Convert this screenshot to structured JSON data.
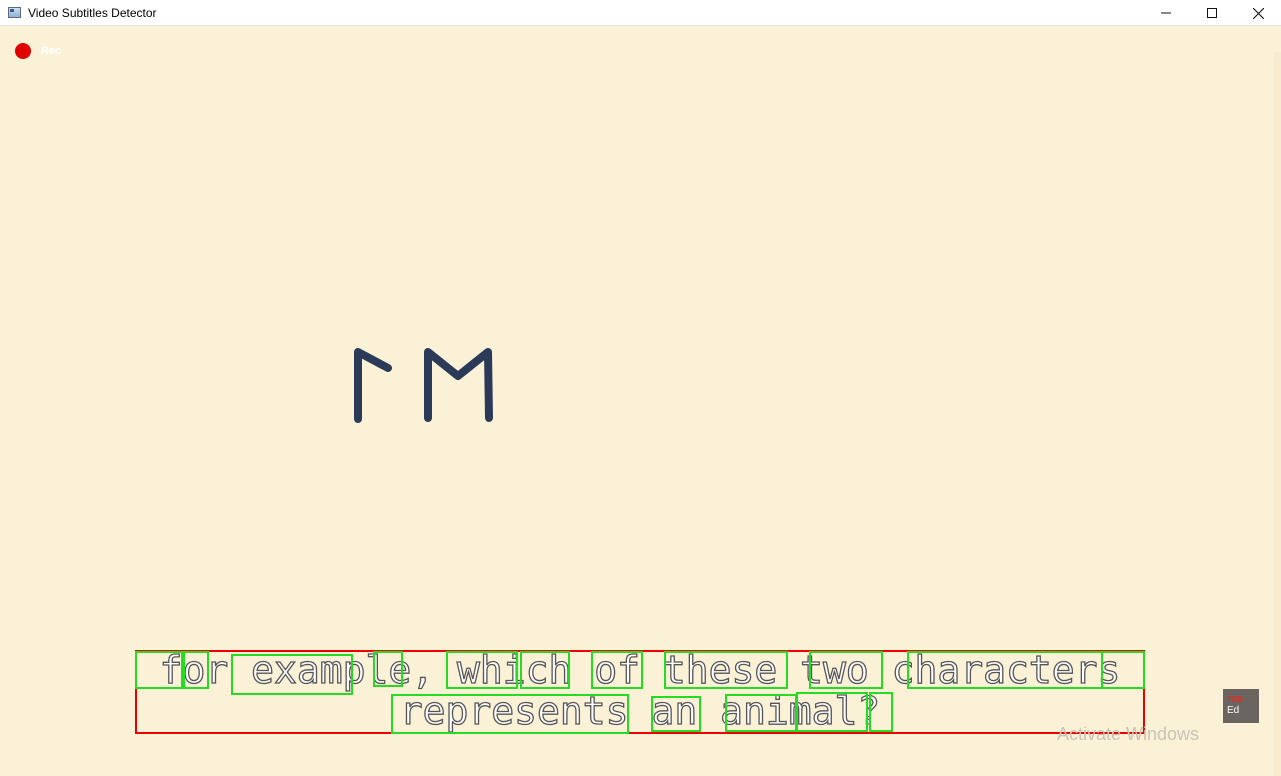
{
  "window": {
    "title": "Video Subtitles Detector",
    "controls": {
      "minimize": "—",
      "maximize": "☐",
      "close": "✕"
    }
  },
  "video": {
    "recording_label": "Rec",
    "glyph_icon": "two-characters-glyphs",
    "subtitle": {
      "line1": "for example, which of these two characters",
      "line2": "represents an animal?"
    },
    "logo": {
      "brand": "TED",
      "suffix": "Ed"
    },
    "watermark": "Activate Windows"
  },
  "colors": {
    "background": "#fbf1d6",
    "subtitle_box": "#ee0000",
    "word_box": "#22dd22",
    "rec_dot": "#e00000",
    "glyph": "#2b3a58"
  }
}
